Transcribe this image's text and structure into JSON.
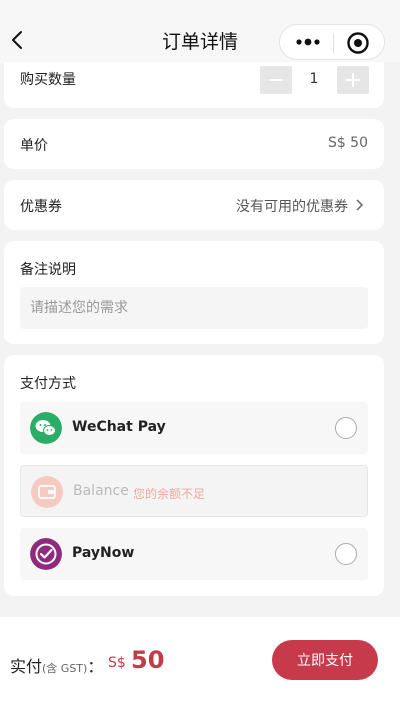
{
  "nav": {
    "title": "订单详情"
  },
  "quantity": {
    "label": "购买数量",
    "value": "1"
  },
  "unit_price": {
    "label": "单价",
    "value": "S$ 50"
  },
  "coupon": {
    "label": "优惠券",
    "value": "没有可用的优惠券"
  },
  "remark": {
    "label": "备注说明",
    "placeholder": "请描述您的需求"
  },
  "payment": {
    "label": "支付方式",
    "options": [
      {
        "name": "WeChat Pay",
        "color": "#2aae67"
      },
      {
        "name": "Balance",
        "note": "您的余额不足",
        "color": "#f6c9c2"
      },
      {
        "name": "PayNow",
        "color": "#8e2b7e"
      }
    ]
  },
  "footer": {
    "total_label": "实付",
    "total_sub": "(含 GST)",
    "total_colon": "：",
    "currency": "S$",
    "amount": "50",
    "pay_button": "立即支付"
  },
  "colors": {
    "accent": "#c73a4b",
    "background": "#f3f3f3"
  }
}
